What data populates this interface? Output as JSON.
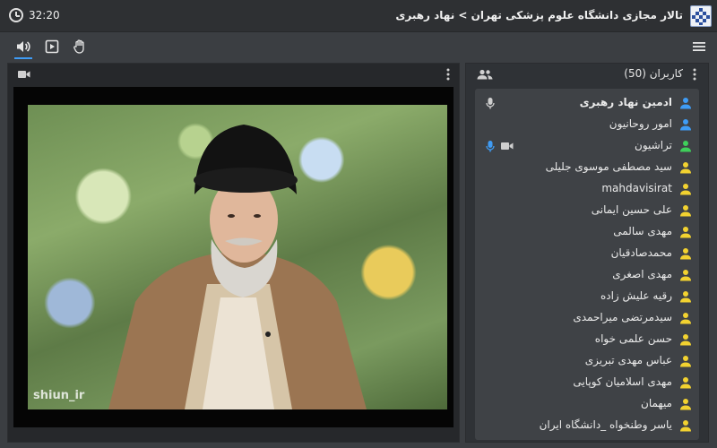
{
  "header": {
    "title": "تالار مجازی دانشگاه علوم پزشکی تهران > نهاد رهبری",
    "time": "32:20"
  },
  "toolbar": {
    "icons": [
      "speaker-icon",
      "play-icon",
      "raise-hand-icon",
      "menu-icon"
    ],
    "active": "speaker-icon"
  },
  "video": {
    "watermark": "shiun_ir"
  },
  "users": {
    "title": "کاربران (50)",
    "list": [
      {
        "name": "ادمین نهاد رهبری",
        "role": "admin"
      },
      {
        "name": "امور روحانیون",
        "role": "admin"
      },
      {
        "name": "تراشیون",
        "role": "presenter"
      },
      {
        "name": "سید مصطفی موسوی جلیلی",
        "role": "viewer"
      },
      {
        "name": "mahdavisirat",
        "role": "viewer"
      },
      {
        "name": "علی حسین ایمانی",
        "role": "viewer"
      },
      {
        "name": "مهدی سالمی",
        "role": "viewer"
      },
      {
        "name": "محمدصادقیان",
        "role": "viewer"
      },
      {
        "name": "مهدی اصغری",
        "role": "viewer"
      },
      {
        "name": "رقیه علیش زاده",
        "role": "viewer"
      },
      {
        "name": "سیدمرتضی میراحمدی",
        "role": "viewer"
      },
      {
        "name": "حسن علمی خواه",
        "role": "viewer"
      },
      {
        "name": "عباس مهدی تبریزی",
        "role": "viewer"
      },
      {
        "name": "مهدی اسلامیان کوپایی",
        "role": "viewer"
      },
      {
        "name": "میهمان",
        "role": "viewer"
      },
      {
        "name": "یاسر وطنخواه _دانشگاه ایران",
        "role": "viewer"
      }
    ]
  },
  "colors": {
    "admin": "#3f9cf5",
    "presenter": "#3fcf5a",
    "viewer": "#f2d230",
    "accent": "#3f9cf5"
  }
}
